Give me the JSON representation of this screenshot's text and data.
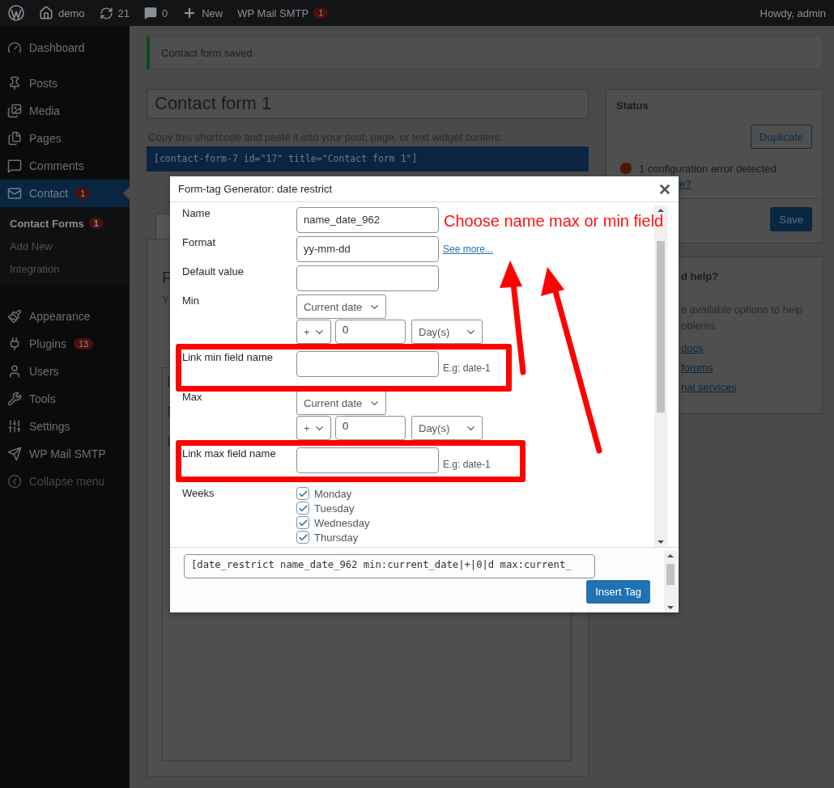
{
  "admin_bar": {
    "site": "demo",
    "updates": "21",
    "comments": "0",
    "new": "New",
    "plugin": {
      "label": "WP Mail SMTP",
      "badge": "1"
    },
    "greeting": "Howdy, admin"
  },
  "sidebar": {
    "items": [
      {
        "label": "Dashboard",
        "selected": false
      },
      {
        "label": "Posts",
        "selected": false
      },
      {
        "label": "Media",
        "selected": false
      },
      {
        "label": "Pages",
        "selected": false
      },
      {
        "label": "Comments",
        "selected": false
      },
      {
        "label": "Contact",
        "selected": true,
        "badge": "1",
        "children": [
          {
            "label": "Contact Forms",
            "selected": true,
            "badge": "1"
          },
          {
            "label": "Add New",
            "selected": false
          },
          {
            "label": "Integration",
            "selected": false
          }
        ]
      },
      {
        "label": "Appearance",
        "selected": false
      },
      {
        "label": "Plugins",
        "selected": false,
        "badge": "13"
      },
      {
        "label": "Users",
        "selected": false
      },
      {
        "label": "Tools",
        "selected": false
      },
      {
        "label": "Settings",
        "selected": false
      },
      {
        "label": "WP Mail SMTP",
        "selected": false
      }
    ],
    "collapse": "Collapse menu"
  },
  "notice": "Contact form saved.",
  "editor": {
    "title": "Contact form 1",
    "shortcode_hint": "Copy this shortcode and paste it into your post, page, or text widget content:",
    "shortcode": "[contact-form-7 id=\"17\" title=\"Contact form 1\"]",
    "tabs": [
      {
        "selected": true
      }
    ],
    "heading": "F",
    "description": "Y",
    "lines": [
      "[",
      "[",
      "["
    ]
  },
  "status": {
    "title": "Status",
    "duplicate": "Duplicate",
    "error": "1 configuration error detected",
    "error_link": "e?",
    "save": "Save"
  },
  "help": {
    "title": "d help?",
    "text_lines": [
      "e available options to help",
      "oblems."
    ],
    "links": [
      "docs",
      "forums",
      "nal services"
    ]
  },
  "dialog": {
    "title": "Form-tag Generator: date restrict",
    "fields": [
      {
        "kind": "text",
        "label": "Name",
        "value": "name_date_962"
      },
      {
        "kind": "text",
        "label": "Format",
        "value": "yy-mm-dd",
        "link": "See more..."
      },
      {
        "kind": "text",
        "label": "Default value"
      },
      {
        "kind": "date",
        "label": "Min",
        "base": "Current date",
        "sign": "+",
        "amount": "0",
        "unit": "Day(s)"
      },
      {
        "kind": "text",
        "label": "Link min field name",
        "hint": "E.g: date-1"
      },
      {
        "kind": "date",
        "label": "Max",
        "base": "Current date",
        "sign": "+",
        "amount": "0",
        "unit": "Day(s)"
      },
      {
        "kind": "text",
        "label": "Link max field name",
        "hint": "E.g: date-1"
      },
      {
        "kind": "checks",
        "label": "Weeks",
        "options": [
          {
            "label": "Monday",
            "checked": true
          },
          {
            "label": "Tuesday",
            "checked": true
          },
          {
            "label": "Wednesday",
            "checked": true
          },
          {
            "label": "Thursday",
            "checked": true
          }
        ]
      }
    ],
    "tag": "[date_restrict name_date_962 min:current_date|+|0|d max:current_",
    "insert": "Insert Tag"
  },
  "annotation": {
    "text": "Choose name max or min field"
  }
}
